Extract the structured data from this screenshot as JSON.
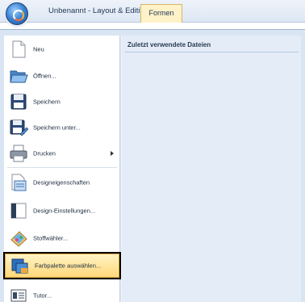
{
  "window": {
    "title": "Unbenannt - Layout & Editing",
    "active_tab": "Formen"
  },
  "recent_files": {
    "header": "Zuletzt verwendete Dateien"
  },
  "menu": {
    "items": [
      {
        "label": "Neu",
        "icon": "new-document-icon"
      },
      {
        "label": "Öffnen...",
        "icon": "open-folder-icon"
      },
      {
        "label": "Speichern",
        "icon": "save-disk-icon"
      },
      {
        "label": "Speichern unter...",
        "icon": "save-as-icon"
      },
      {
        "label": "Drucken",
        "icon": "printer-icon",
        "has_submenu": true
      },
      {
        "label": "Designeigenschaften",
        "icon": "design-properties-icon"
      },
      {
        "label": "Design-Einstellungen...",
        "icon": "design-settings-icon"
      },
      {
        "label": "Stoffwähler...",
        "icon": "fabric-selector-icon"
      },
      {
        "label": "Farbpalette auswählen...",
        "icon": "color-palette-icon",
        "highlighted": true
      },
      {
        "label": "Tutor...",
        "icon": "tutor-icon"
      }
    ]
  },
  "colors": {
    "highlight": "#ffd87a",
    "menu_bg": "#d9e5f3",
    "recent_bg": "#e3ecf7"
  }
}
